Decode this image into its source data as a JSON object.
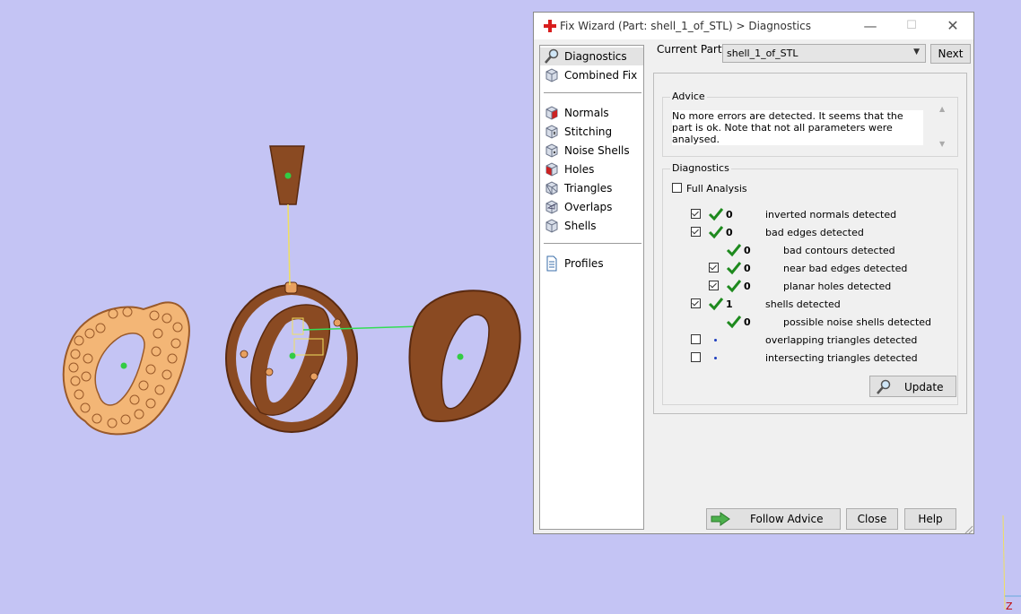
{
  "viewport": {
    "background": "#c4c4f4",
    "axis_label": "Z"
  },
  "window": {
    "title": "Fix Wizard (Part: shell_1_of_STL) > Diagnostics",
    "minimize": "—",
    "maximize": "☐",
    "close": "✕"
  },
  "nav": {
    "top_items": [
      {
        "label": "Diagnostics",
        "icon": "magnifier-icon",
        "selected": true
      },
      {
        "label": "Combined Fix",
        "icon": "cube-icon"
      }
    ],
    "fix_items": [
      {
        "label": "Normals",
        "icon": "normals-cube-icon"
      },
      {
        "label": "Stitching",
        "icon": "stitching-cube-icon"
      },
      {
        "label": "Noise Shells",
        "icon": "noise-shells-cube-icon"
      },
      {
        "label": "Holes",
        "icon": "holes-cube-icon"
      },
      {
        "label": "Triangles",
        "icon": "triangles-cube-icon"
      },
      {
        "label": "Overlaps",
        "icon": "overlaps-cube-icon"
      },
      {
        "label": "Shells",
        "icon": "shells-cube-icon"
      }
    ],
    "bottom_items": [
      {
        "label": "Profiles",
        "icon": "document-icon"
      }
    ]
  },
  "current_part": {
    "label": "Current Part:",
    "value": "shell_1_of_STL"
  },
  "next_label": "Next",
  "advice": {
    "legend": "Advice",
    "text": "No more errors are detected. It seems that the part is ok. Note that not all parameters were analysed."
  },
  "diagnostics": {
    "legend": "Diagnostics",
    "full_analysis_label": "Full Analysis",
    "full_analysis_checked": false,
    "rows": [
      {
        "count": "0",
        "label": "inverted normals detected",
        "checked": true,
        "has_check": true,
        "status": "ok"
      },
      {
        "count": "0",
        "label": "bad edges detected",
        "checked": true,
        "has_check": true,
        "status": "ok"
      },
      {
        "count": "0",
        "label": "bad contours detected",
        "checked": false,
        "has_check": false,
        "status": "ok"
      },
      {
        "count": "0",
        "label": "near bad edges detected",
        "checked": true,
        "has_check": true,
        "status": "ok"
      },
      {
        "count": "0",
        "label": "planar holes detected",
        "checked": true,
        "has_check": true,
        "status": "ok"
      },
      {
        "count": "1",
        "label": "shells detected",
        "checked": true,
        "has_check": true,
        "status": "ok"
      },
      {
        "count": "0",
        "label": "possible noise shells detected",
        "checked": false,
        "has_check": false,
        "status": "ok"
      },
      {
        "count": "",
        "label": "overlapping triangles detected",
        "checked": false,
        "has_check": true,
        "status": "not-run"
      },
      {
        "count": "",
        "label": "intersecting triangles detected",
        "checked": false,
        "has_check": true,
        "status": "not-run"
      }
    ],
    "update_label": "Update"
  },
  "buttons": {
    "follow_advice": "Follow Advice",
    "close": "Close",
    "help": "Help"
  },
  "colors": {
    "accent_green": "#1e8a1e",
    "part_orange": "#f0b070",
    "part_brown": "#8a4a22",
    "highlight_green": "#00dd44",
    "selection_yellow": "#f0e060"
  }
}
